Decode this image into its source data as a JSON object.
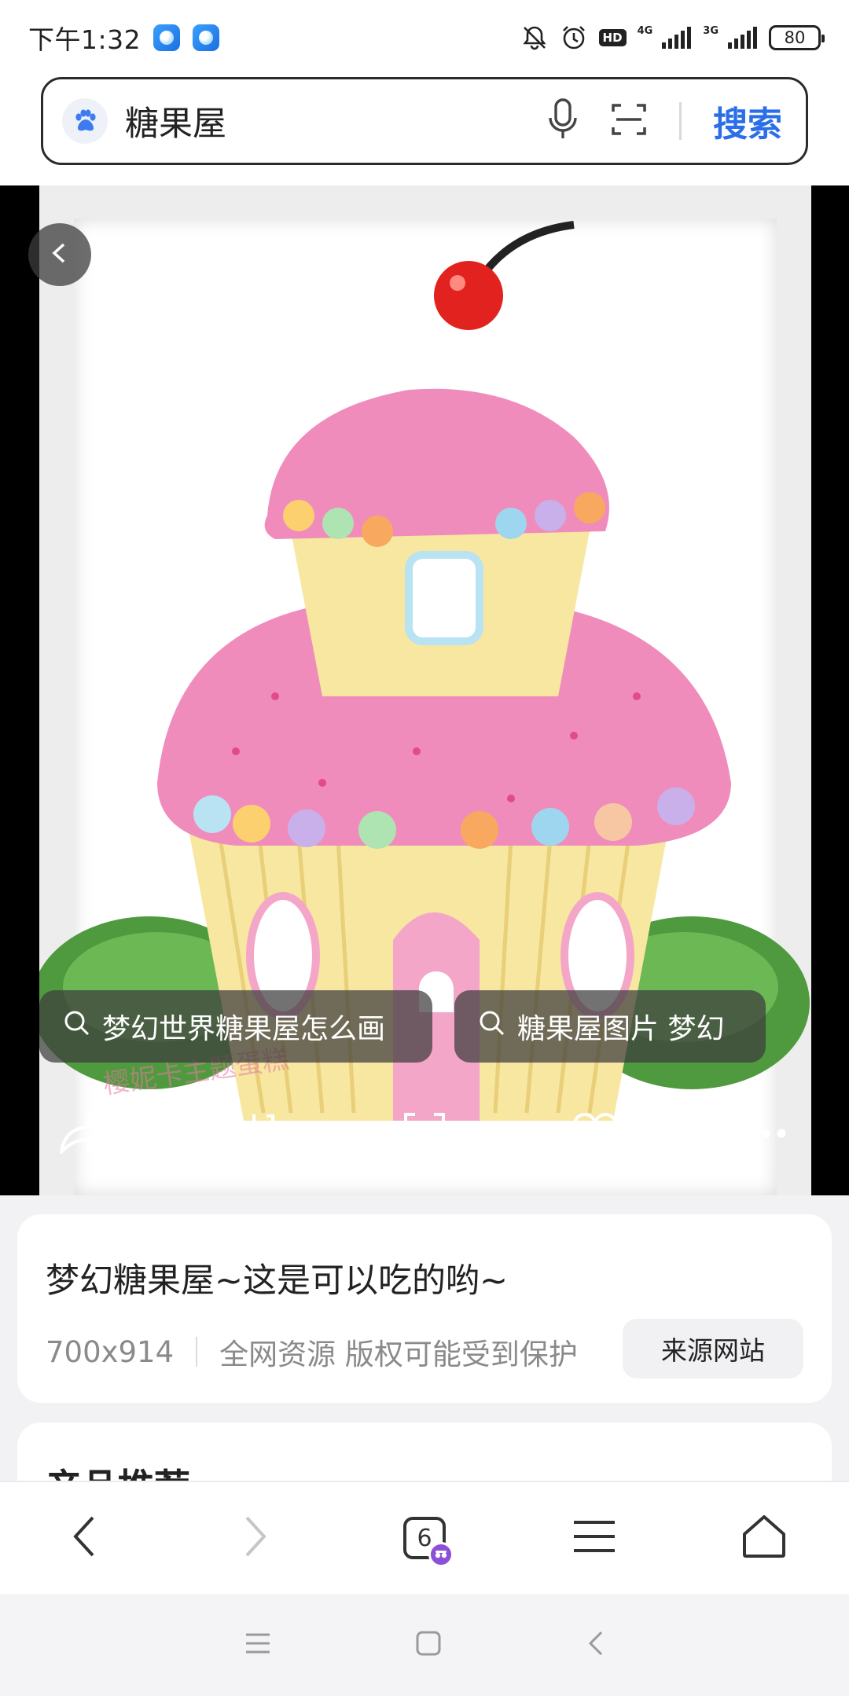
{
  "status_bar": {
    "time": "下午1:32",
    "network_1": "4G",
    "network_2": "3G",
    "hd": "HD",
    "battery": "80"
  },
  "search": {
    "query": "糖果屋",
    "button_label": "搜索"
  },
  "viewer": {
    "watermark": "樱妮卡主题蛋糕",
    "chips": [
      {
        "label": "梦幻世界糖果屋怎么画"
      },
      {
        "label": "糖果屋图片 梦幻"
      }
    ]
  },
  "info": {
    "title": "梦幻糖果屋~这是可以吃的哟~",
    "dimensions": "700x914",
    "copyright": "全网资源 版权可能受到保护",
    "source_button": "来源网站"
  },
  "recommend": {
    "title": "产品推荐"
  },
  "browser_nav": {
    "tab_count": "6"
  },
  "colors": {
    "accent_blue": "#2a6fe8",
    "frosting_pink": "#f08cbc",
    "cake_yellow": "#f7e7a1",
    "cherry_red": "#e2221f",
    "incognito_purple": "#8b4fd8"
  },
  "icons": [
    "bell-muted-icon",
    "alarm-icon",
    "signal-icon",
    "battery-icon",
    "paw-icon",
    "microphone-icon",
    "scan-icon",
    "back-chevron-icon",
    "search-icon",
    "share-icon",
    "download-icon",
    "visual-search-icon",
    "heart-icon",
    "more-icon",
    "nav-back-icon",
    "nav-forward-icon",
    "tabs-icon",
    "menu-icon",
    "home-icon"
  ]
}
